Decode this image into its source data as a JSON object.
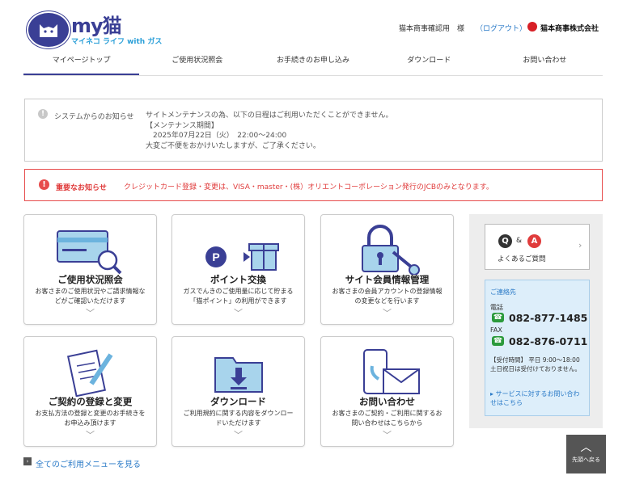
{
  "header": {
    "logo_title": "my猫",
    "logo_sub": "マイネコ ライフ with ガス",
    "user_name": "猫本商事確認用　様",
    "logout": "（ログアウト）",
    "corp_name": "猫本商事株式会社"
  },
  "nav": [
    {
      "label": "マイページトップ",
      "active": true
    },
    {
      "label": "ご使用状況照会"
    },
    {
      "label": "お手続きのお申し込み"
    },
    {
      "label": "ダウンロード"
    },
    {
      "label": "お問い合わせ"
    }
  ],
  "notice": {
    "label": "システムからのお知らせ",
    "lines": [
      "サイトメンテナンスの為、以下の日程はご利用いただくことができません。",
      "【メンテナンス期間】",
      "　2025年07月22日（火）　22:00～24:00",
      "大変ご不便をおかけいたしますが、ご了承ください。"
    ]
  },
  "important": {
    "label": "重要なお知らせ",
    "text": "クレジットカード登録・変更は、VISA・master・(株）オリエントコーポレーション発行のJCBのみとなります。"
  },
  "cards": [
    {
      "title": "ご使用状況照会",
      "desc": "お客さまのご使用状況やご請求情報などがご確認いただけます"
    },
    {
      "title": "ポイント交換",
      "desc": "ガスでんきのご使用量に応じて貯まる「猫ポイント」の利用ができます"
    },
    {
      "title": "サイト会員情報管理",
      "desc": "お客さまの会員アカウントの登録情報の変更などを行います"
    },
    {
      "title": "ご契約の登録と変更",
      "desc": "お支払方法の登録と変更のお手続きをお申込み頂けます"
    },
    {
      "title": "ダウンロード",
      "desc": "ご利用規約に関する内容をダウンロードいただけます"
    },
    {
      "title": "お問い合わせ",
      "desc": "お客さまのご契約・ご利用に関するお問い合わせはこちらから"
    }
  ],
  "all_menu_link": "全てのご利用メニューを見る",
  "faq": {
    "q": "Q",
    "amp": "&",
    "a": "A",
    "label": "よくあるご質問"
  },
  "contact": {
    "title": "ご連絡先",
    "tel_label": "電話",
    "tel": "082-877-1485",
    "fax_label": "FAX",
    "fax": "082-876-0711",
    "hours1": "【受付時間】 平日 9:00～18:00",
    "hours2": "土日祝日は受付けておりません。",
    "service_link": "サービスに対するお問い合わせはこちら"
  },
  "pagetop": {
    "label": "先頭へ戻る"
  },
  "colors": {
    "brand": "#3a3f95",
    "accent_red": "#e03c3c",
    "link": "#2a7ac7"
  }
}
